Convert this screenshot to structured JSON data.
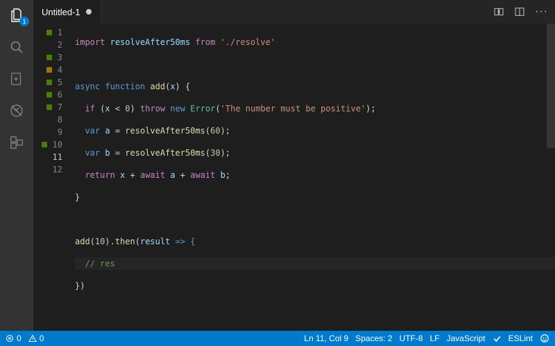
{
  "activity": {
    "explorer_badge": "1"
  },
  "tab": {
    "title": "Untitled-1"
  },
  "gutter": [
    {
      "n": "1",
      "mark": "green"
    },
    {
      "n": "2",
      "mark": ""
    },
    {
      "n": "3",
      "mark": "green"
    },
    {
      "n": "4",
      "mark": "yellow"
    },
    {
      "n": "5",
      "mark": "green"
    },
    {
      "n": "6",
      "mark": "green"
    },
    {
      "n": "7",
      "mark": "green"
    },
    {
      "n": "8",
      "mark": ""
    },
    {
      "n": "9",
      "mark": ""
    },
    {
      "n": "10",
      "mark": "green"
    },
    {
      "n": "11",
      "mark": "",
      "current": true
    },
    {
      "n": "12",
      "mark": ""
    }
  ],
  "code": {
    "l1": {
      "import": "import",
      "sym": "resolveAfter50ms",
      "from": "from",
      "path": "'./resolve'"
    },
    "l3": {
      "async": "async",
      "function": "function",
      "name": "add",
      "param": "x",
      "open": ") {"
    },
    "l4": {
      "if": "if",
      "cond_a": "x",
      "cond_op": " < ",
      "cond_b": "0",
      "throw": "throw",
      "new": "new",
      "err": "Error",
      "msg": "'The number must be positive'",
      "end": ");"
    },
    "l5": {
      "var": "var",
      "id": "a",
      "eq": " = ",
      "call": "resolveAfter50ms",
      "arg": "60",
      "end": ");"
    },
    "l6": {
      "var": "var",
      "id": "b",
      "eq": " = ",
      "call": "resolveAfter50ms",
      "arg": "30",
      "end": ");"
    },
    "l7": {
      "return": "return",
      "x": "x",
      "plus1": " + ",
      "await1": "await",
      "a": "a",
      "plus2": " + ",
      "await2": "await",
      "b": "b",
      "end": ";"
    },
    "l8": {
      "brace": "}"
    },
    "l10": {
      "call": "add",
      "arg": "10",
      "then": ".then",
      "open": "(",
      "param": "result",
      "arrow": " => {"
    },
    "l11": {
      "comment": "// res"
    },
    "l12": {
      "close": "})"
    }
  },
  "status": {
    "errors": "0",
    "warnings": "0",
    "cursor": "Ln 11, Col 9",
    "spaces": "Spaces: 2",
    "encoding": "UTF-8",
    "eol": "LF",
    "language": "JavaScript",
    "eslint": "ESLint"
  }
}
